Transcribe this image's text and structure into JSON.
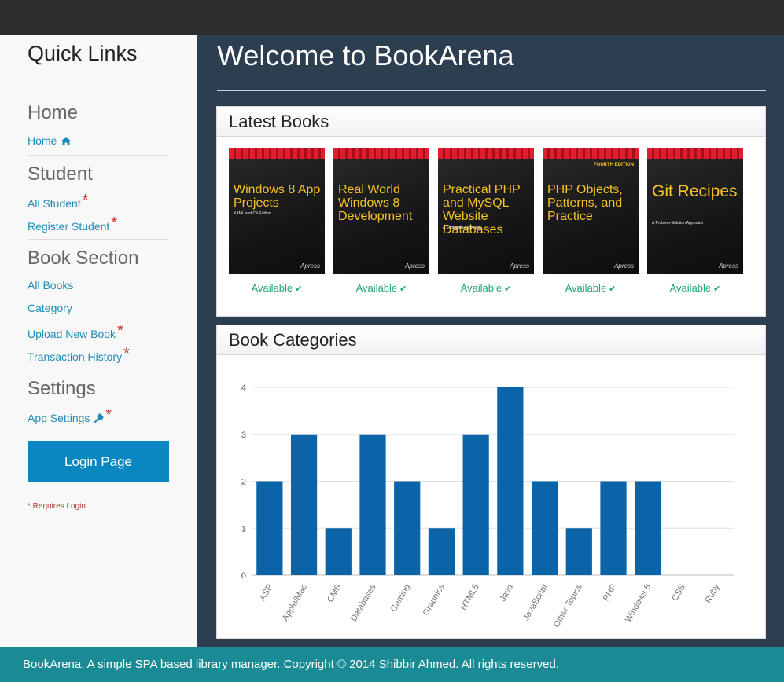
{
  "sidebar": {
    "title": "Quick Links",
    "sections": {
      "home": "Home",
      "student": "Student",
      "book": "Book Section",
      "settings": "Settings"
    },
    "links": {
      "home": "Home",
      "all_student": "All Student",
      "register_student": "Register Student",
      "all_books": "All Books",
      "category": "Category",
      "upload_book": "Upload New Book",
      "transaction_history": "Transaction History",
      "app_settings": "App Settings"
    },
    "star": "*",
    "login_button": "Login Page",
    "requires_login_note": "* Requires Login",
    "link_color": "#1e8cb8",
    "star_color": "#c9302c"
  },
  "main": {
    "title": "Welcome to BookArena",
    "latest_books": {
      "heading": "Latest Books",
      "books": [
        {
          "title": "Windows 8 App Projects",
          "subtitle": "XAML and C# Edition",
          "status": "Available"
        },
        {
          "title": "Real World Windows 8 Development",
          "status": "Available"
        },
        {
          "title": "Practical PHP and MySQL Website Databases",
          "subtitle": "A Simplified Approach",
          "status": "Available"
        },
        {
          "title": "PHP Objects, Patterns, and Practice",
          "edition": "FOURTH EDITION",
          "status": "Available"
        },
        {
          "title": "Git Recipes",
          "subtitle": "A Problem-Solution Approach",
          "status": "Available"
        }
      ],
      "publisher": "Apress",
      "available_color": "#1fa67a"
    },
    "categories": {
      "heading": "Book Categories"
    }
  },
  "chart_data": {
    "type": "bar",
    "categories": [
      "ASP",
      "Apple/Mac",
      "CMS",
      "Databases",
      "Gaming",
      "Graphics",
      "HTML5",
      "Java",
      "JavaScript",
      "Other Topics",
      "PHP",
      "Windows 8",
      "CSS",
      "Ruby"
    ],
    "values": [
      2,
      3,
      1,
      3,
      2,
      1,
      3,
      4,
      2,
      1,
      2,
      2,
      0,
      0
    ],
    "yticks": [
      "0",
      "1",
      "2",
      "3",
      "4"
    ],
    "ylim": [
      0,
      4
    ],
    "grid": true,
    "bar_color": "#0b63a8"
  },
  "footer": {
    "text_before": "BookArena: A simple SPA based library manager. Copyright © 2014 ",
    "author_link": "Shibbir Ahmed",
    "text_after": ". All rights reserved."
  }
}
